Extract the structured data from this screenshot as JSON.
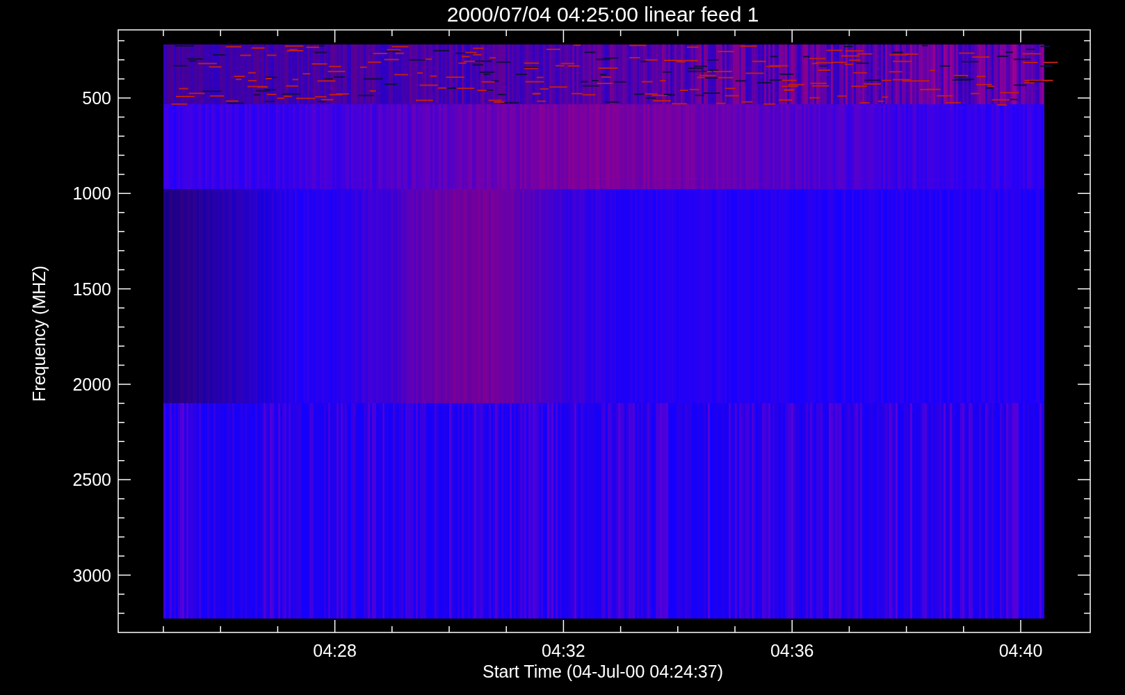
{
  "plot": {
    "title": "2000/07/04 04:25:00 linear feed 1",
    "y_axis": {
      "label": "Frequency (MHZ)",
      "ticks": [
        "500",
        "1000",
        "1500",
        "2000",
        "2500",
        "3000"
      ]
    },
    "x_axis": {
      "label": "Start Time (04-Jul-00 04:24:37)",
      "ticks": [
        "04:28",
        "04:32",
        "04:36",
        "04:40"
      ]
    }
  }
}
